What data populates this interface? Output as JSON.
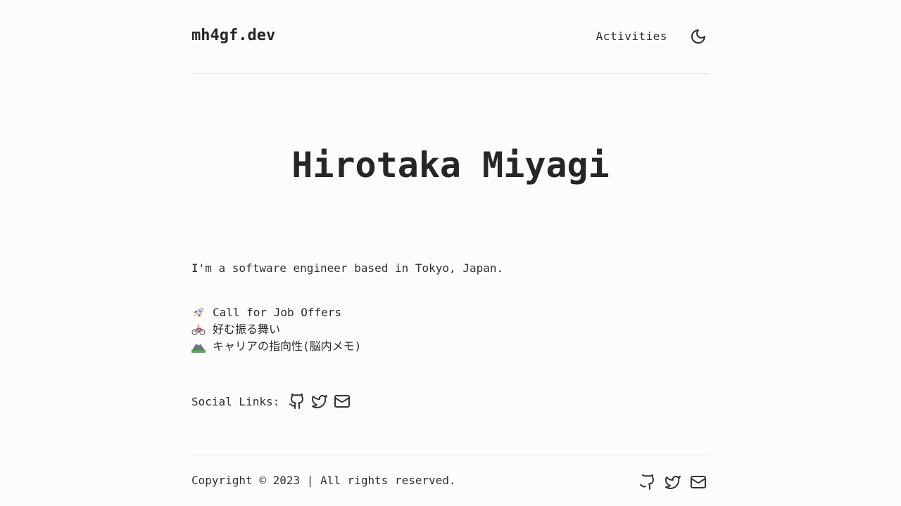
{
  "header": {
    "logo": "mh4gf.dev",
    "nav": [
      {
        "label": "Activities"
      }
    ],
    "theme_toggle_icon": "moon-icon"
  },
  "hero": {
    "title": "Hirotaka Miyagi"
  },
  "intro": "I'm a software engineer based in Tokyo, Japan.",
  "articles": [
    {
      "icon": "rocket-icon",
      "label": "Call for Job Offers"
    },
    {
      "icon": "bicycle-icon",
      "label": "好む振る舞い"
    },
    {
      "icon": "mountain-icon",
      "label": "キャリアの指向性(脳内メモ)"
    }
  ],
  "social": {
    "label": "Social Links:",
    "icons": [
      "github-icon",
      "twitter-icon",
      "mail-icon"
    ]
  },
  "footer": {
    "copyright": "Copyright © 2023 | All rights reserved.",
    "icons": [
      "github-icon",
      "twitter-icon",
      "mail-icon"
    ]
  },
  "colors": {
    "background": "#fcfdfb",
    "text": "#2a2a2a",
    "divider": "#e6e8e5"
  }
}
